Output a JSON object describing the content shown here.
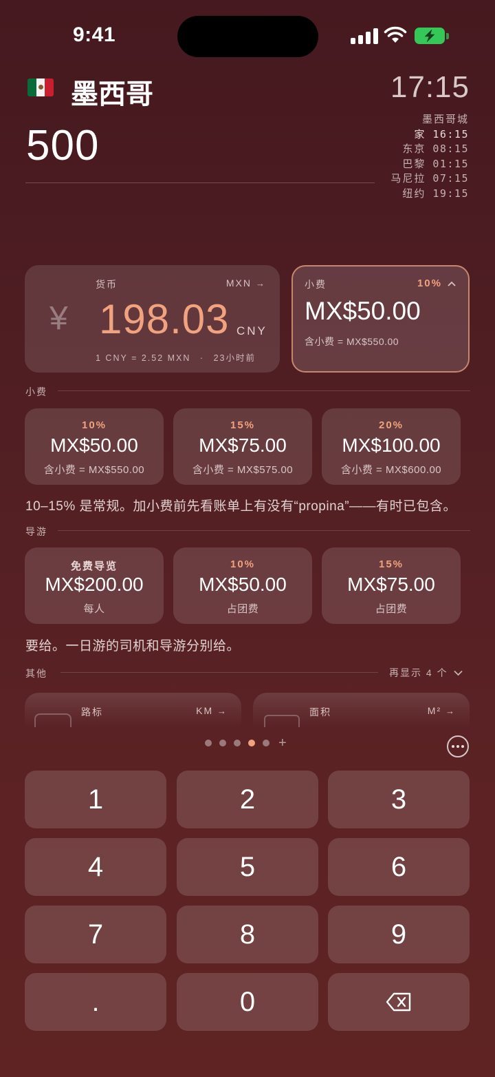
{
  "status": {
    "time": "9:41"
  },
  "header": {
    "flag": "mexico-flag",
    "country": "墨西哥",
    "amount": "500",
    "clock": "17:15",
    "city": "墨西哥城",
    "zones": [
      {
        "name": "家",
        "time": "16:15"
      },
      {
        "name": "东京",
        "time": "08:15"
      },
      {
        "name": "巴黎",
        "time": "01:15"
      },
      {
        "name": "马尼拉",
        "time": "07:15"
      },
      {
        "name": "纽约",
        "time": "19:15"
      }
    ]
  },
  "currency_card": {
    "label": "货币",
    "from_code": "MXN",
    "symbol": "¥",
    "value": "198.03",
    "to_code": "CNY",
    "rate": "1 CNY = 2.52 MXN",
    "separator": "·",
    "updated": "23小时前"
  },
  "tip_card": {
    "label": "小费",
    "percent": "10%",
    "value": "MX$50.00",
    "total": "含小费 = MX$550.00"
  },
  "tips": {
    "title": "小费",
    "options": [
      {
        "percent": "10%",
        "value": "MX$50.00",
        "sub": "含小费 = MX$550.00"
      },
      {
        "percent": "15%",
        "value": "MX$75.00",
        "sub": "含小费 = MX$575.00"
      },
      {
        "percent": "20%",
        "value": "MX$100.00",
        "sub": "含小费 = MX$600.00"
      }
    ],
    "note": "10–15% 是常规。加小费前先看账单上有没有“propina”——有时已包含。"
  },
  "guide": {
    "title": "导游",
    "options": [
      {
        "percent": "免费导览",
        "value": "MX$200.00",
        "sub": "每人"
      },
      {
        "percent": "10%",
        "value": "MX$50.00",
        "sub": "占团费"
      },
      {
        "percent": "15%",
        "value": "MX$75.00",
        "sub": "占团费"
      }
    ],
    "note": "要给。一日游的司机和导游分别给。"
  },
  "other": {
    "title": "其他",
    "show_more": "再显示 4 个",
    "cards": [
      {
        "label": "路标",
        "unit": "KM"
      },
      {
        "label": "面积",
        "unit": "M²"
      }
    ]
  },
  "pager": {
    "count": 5,
    "active": 4,
    "add": "+"
  },
  "keypad": {
    "keys": [
      "1",
      "2",
      "3",
      "4",
      "5",
      "6",
      "7",
      "8",
      "9",
      ".",
      "0"
    ]
  },
  "colors": {
    "accent": "#f0a37e",
    "background": "#4f1e23",
    "battery": "#36c759"
  }
}
